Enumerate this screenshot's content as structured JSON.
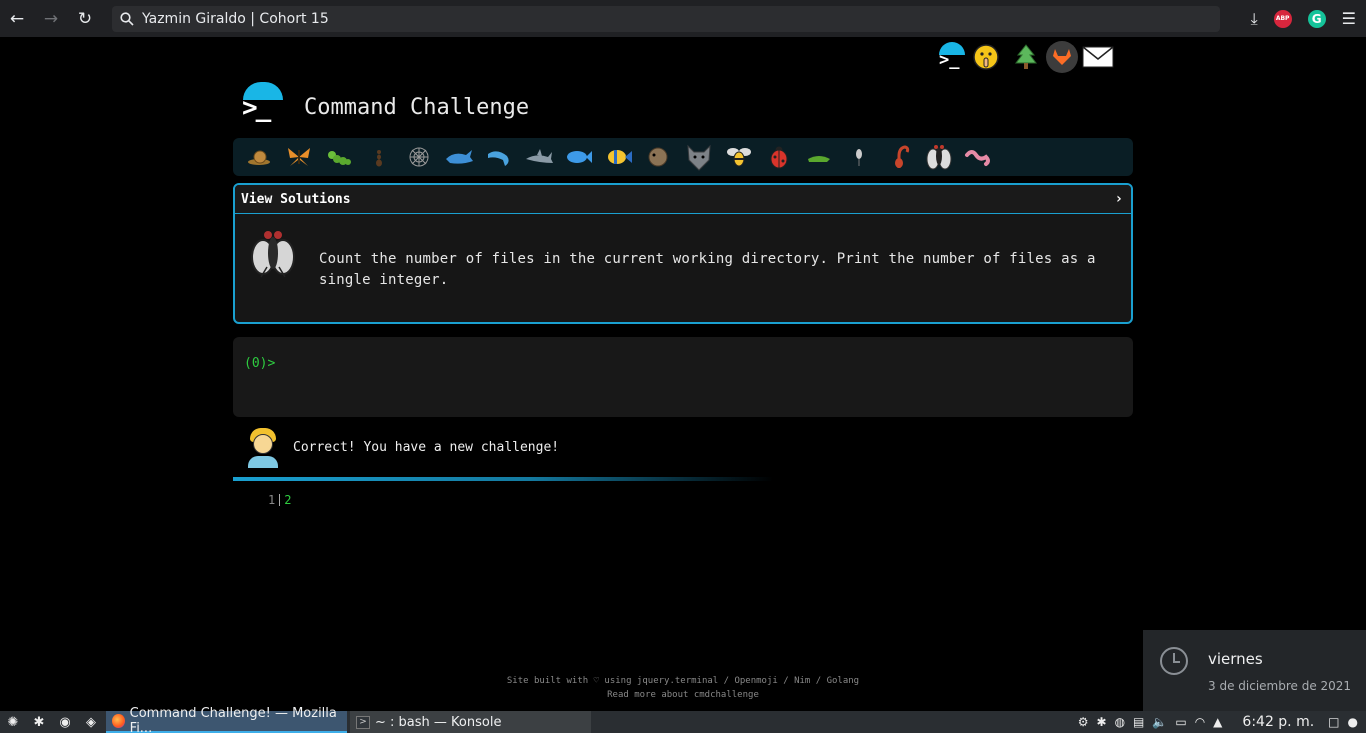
{
  "browser": {
    "url_text": "Yazmin Giraldo | Cohort 15",
    "abp_label": "ABP",
    "grammarly_label": "G"
  },
  "site": {
    "title": "Command Challenge",
    "prompt_glyph": ">_"
  },
  "challenge_icons": [
    "snail-icon",
    "butterfly-icon",
    "caterpillar-icon",
    "ant-icon",
    "spider-web-icon",
    "whale-icon",
    "dolphin-icon",
    "shark-icon",
    "fish-icon",
    "tropical-fish-icon",
    "pufferfish-icon",
    "wolf-icon",
    "bee-icon",
    "ladybug-icon",
    "cricket-icon",
    "mosquito-icon",
    "scorpion-icon",
    "fly-icon",
    "worm-icon"
  ],
  "panel": {
    "header_label": "View Solutions",
    "chevron": "›",
    "description": "Count the number of files in the current working directory. Print the number of files as a single integer."
  },
  "terminal": {
    "prompt": "(0)>"
  },
  "feedback": {
    "message": "Correct! You have a new challenge!",
    "progress_fraction": 0.105
  },
  "steps": {
    "done": "1",
    "current": "2"
  },
  "footer": {
    "line1": "Site built with ♡ using jquery.terminal / Openmoji / Nim / Golang",
    "line2": "Read more about cmdchallenge"
  },
  "notification": {
    "day": "viernes",
    "date": "3 de diciembre de 2021"
  },
  "taskbar": {
    "task1_title": "Command Challenge! — Mozilla Fi...",
    "task2_title": "~ : bash — Konsole",
    "time": "6:42 p. m."
  },
  "colors": {
    "accent": "#1aa0d0",
    "prompt_green": "#2ecc40",
    "panel_bg": "#161616",
    "strip_bg": "#0a1e25"
  }
}
